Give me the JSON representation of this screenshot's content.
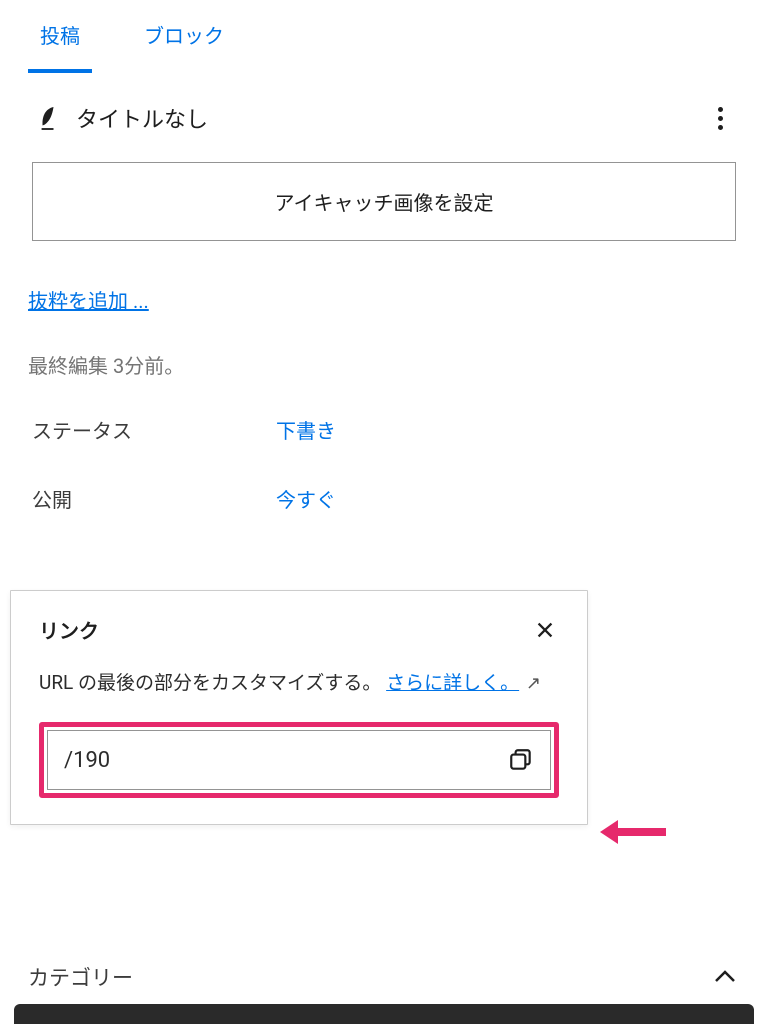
{
  "tabs": {
    "post": "投稿",
    "block": "ブロック"
  },
  "post": {
    "title": "タイトルなし",
    "featured_image_button": "アイキャッチ画像を設定",
    "excerpt_link": "抜粋を追加 ...",
    "last_edited": "最終編集 3分前。"
  },
  "fields": {
    "status_label": "ステータス",
    "status_value": "下書き",
    "publish_label": "公開",
    "publish_value": "今すぐ"
  },
  "popover": {
    "title": "リンク",
    "desc_prefix": "URL の最後の部分をカスタマイズする。 ",
    "learn_more": "さらに詳しく。",
    "url_value": "/190"
  },
  "category": {
    "label": "カテゴリー"
  }
}
